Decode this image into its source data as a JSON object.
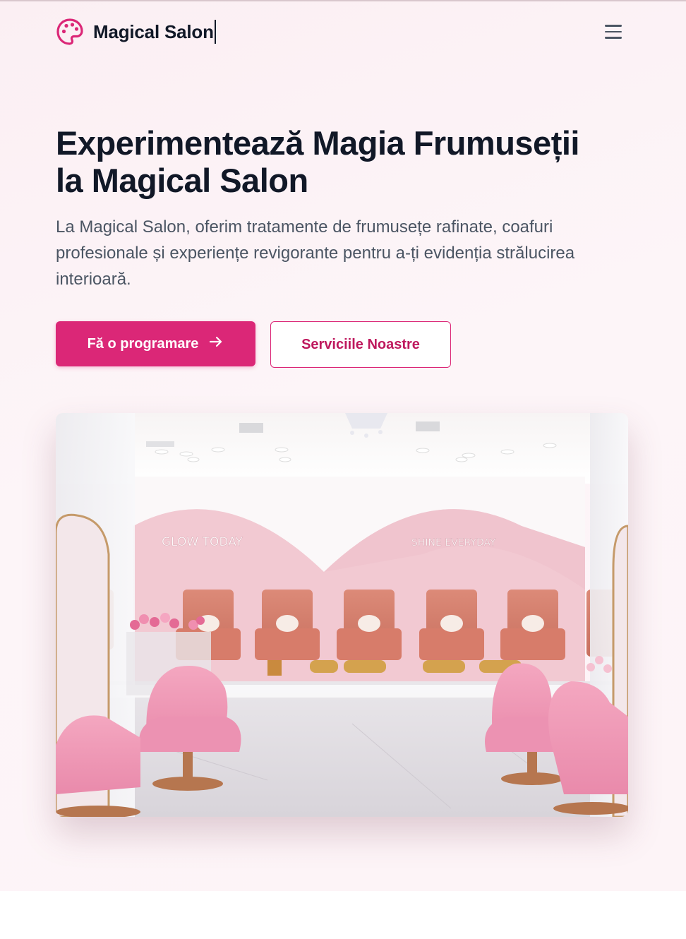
{
  "brand": {
    "name": "Magical Salon",
    "icon": "palette-icon",
    "color": "#db2777"
  },
  "nav": {
    "menu_icon": "hamburger-menu-icon"
  },
  "hero": {
    "title_line1": "Experimentează Magia Frumuseții",
    "title_line2": "la Magical Salon",
    "subtitle": "La Magical Salon, oferim tratamente de frumusețe rafinate, coafuri profesionale și experiențe revigorante pentru a-ți evidenția strălucirea interioară.",
    "primary_button": "Fă o programare",
    "primary_icon": "arrow-right-icon",
    "secondary_button": "Serviciile Noastre"
  },
  "image": {
    "wall_text_left": "GLOW TODAY",
    "wall_text_right": "SHINE EVERYDAY"
  },
  "colors": {
    "accent": "#db2777",
    "title": "#111827",
    "body_text": "#4b5563"
  }
}
